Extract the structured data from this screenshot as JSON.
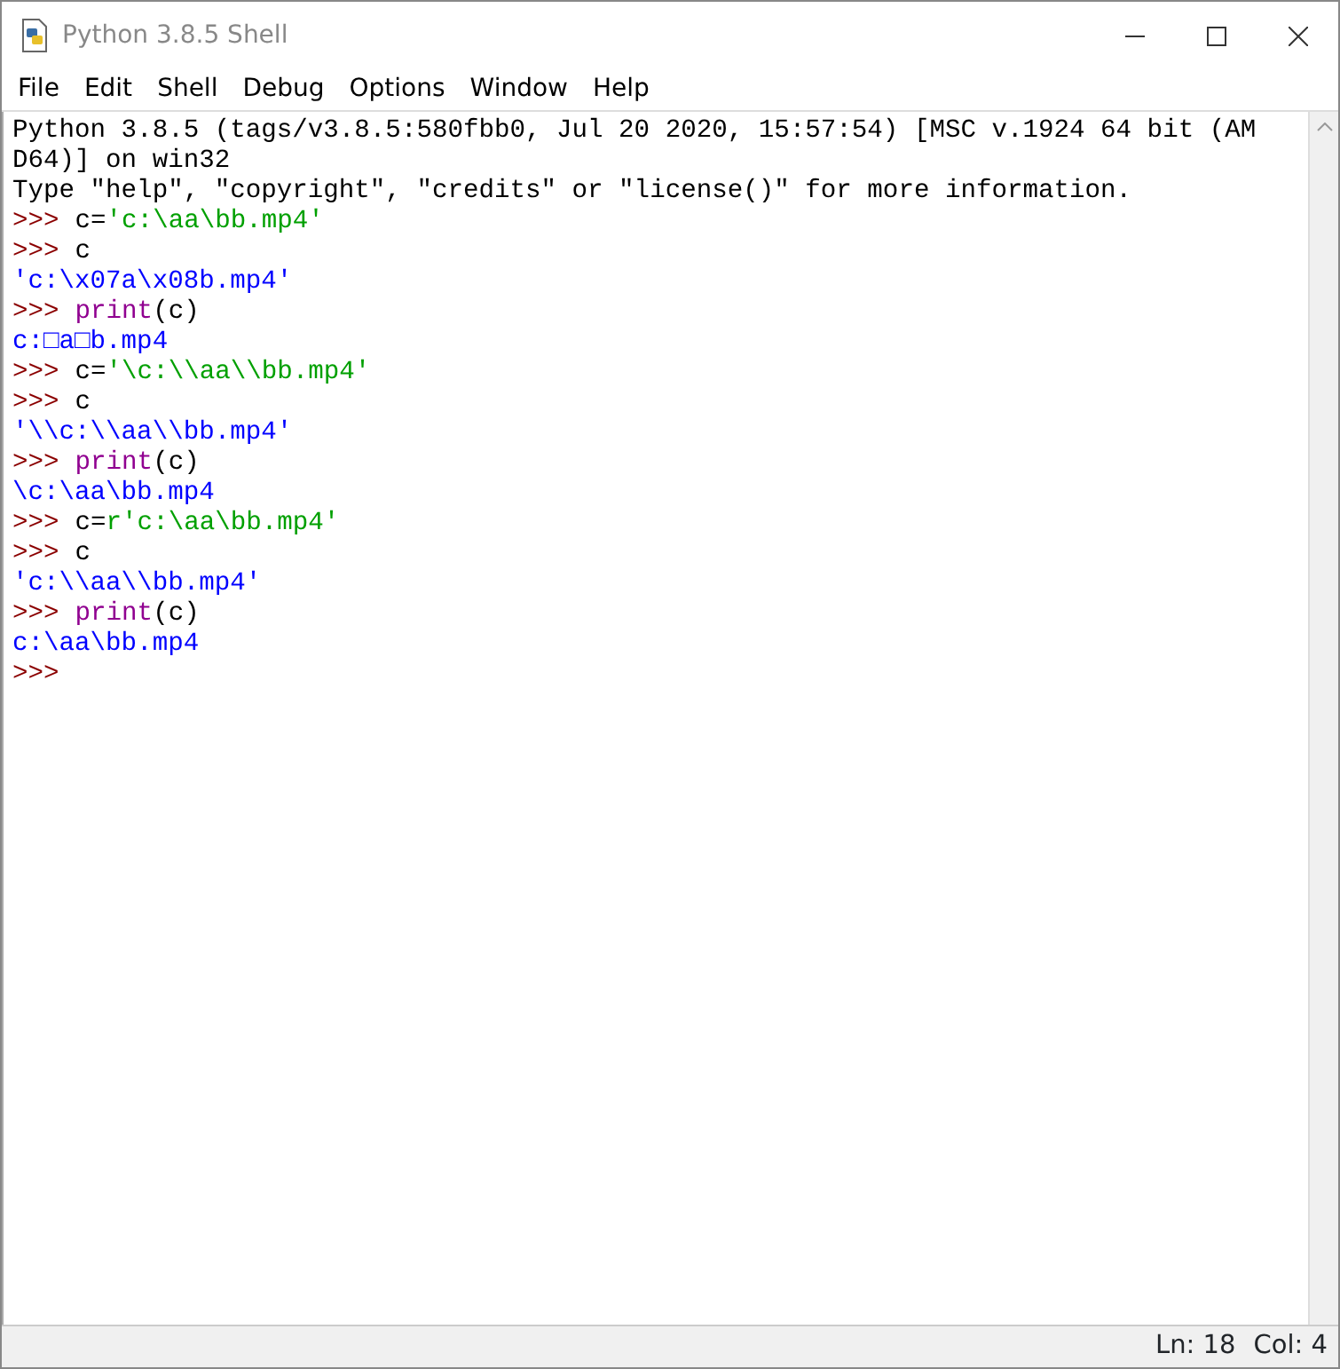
{
  "window": {
    "title": "Python 3.8.5 Shell"
  },
  "menu": [
    "File",
    "Edit",
    "Shell",
    "Debug",
    "Options",
    "Window",
    "Help"
  ],
  "lines": [
    [
      {
        "kind": "plain",
        "text": "Python 3.8.5 (tags/v3.8.5:580fbb0, Jul 20 2020, 15:57:54) [MSC v.1924 64 bit (AM"
      }
    ],
    [
      {
        "kind": "plain",
        "text": "D64)] on win32"
      }
    ],
    [
      {
        "kind": "plain",
        "text": "Type \"help\", \"copyright\", \"credits\" or \"license()\" for more information."
      }
    ],
    [
      {
        "kind": "prompt",
        "text": ">>>"
      },
      {
        "kind": "plain",
        "text": "c="
      },
      {
        "kind": "string",
        "text": "'c:\\aa\\bb.mp4'"
      }
    ],
    [
      {
        "kind": "prompt",
        "text": ">>>"
      },
      {
        "kind": "plain",
        "text": "c"
      }
    ],
    [
      {
        "kind": "output",
        "text": "'c:\\x07a\\x08b.mp4'"
      }
    ],
    [
      {
        "kind": "prompt",
        "text": ">>>"
      },
      {
        "kind": "keyword",
        "text": "print"
      },
      {
        "kind": "plain",
        "text": "(c)"
      }
    ],
    [
      {
        "kind": "output",
        "text": "c:□a□b.mp4"
      }
    ],
    [
      {
        "kind": "prompt",
        "text": ">>>"
      },
      {
        "kind": "plain",
        "text": "c="
      },
      {
        "kind": "string",
        "text": "'\\c:\\\\aa\\\\bb.mp4'"
      }
    ],
    [
      {
        "kind": "prompt",
        "text": ">>>"
      },
      {
        "kind": "plain",
        "text": "c"
      }
    ],
    [
      {
        "kind": "output",
        "text": "'\\\\c:\\\\aa\\\\bb.mp4'"
      }
    ],
    [
      {
        "kind": "prompt",
        "text": ">>>"
      },
      {
        "kind": "keyword",
        "text": "print"
      },
      {
        "kind": "plain",
        "text": "(c)"
      }
    ],
    [
      {
        "kind": "output",
        "text": "\\c:\\aa\\bb.mp4"
      }
    ],
    [
      {
        "kind": "prompt",
        "text": ">>>"
      },
      {
        "kind": "plain",
        "text": "c="
      },
      {
        "kind": "string",
        "text": "r'c:\\aa\\bb.mp4'"
      }
    ],
    [
      {
        "kind": "prompt",
        "text": ">>>"
      },
      {
        "kind": "plain",
        "text": "c"
      }
    ],
    [
      {
        "kind": "output",
        "text": "'c:\\\\aa\\\\bb.mp4'"
      }
    ],
    [
      {
        "kind": "prompt",
        "text": ">>>"
      },
      {
        "kind": "keyword",
        "text": "print"
      },
      {
        "kind": "plain",
        "text": "(c)"
      }
    ],
    [
      {
        "kind": "output",
        "text": "c:\\aa\\bb.mp4"
      }
    ],
    [
      {
        "kind": "prompt",
        "text": ">>>"
      }
    ]
  ],
  "status_bar": {
    "line": "Ln: 18",
    "column": "Col: 4"
  }
}
